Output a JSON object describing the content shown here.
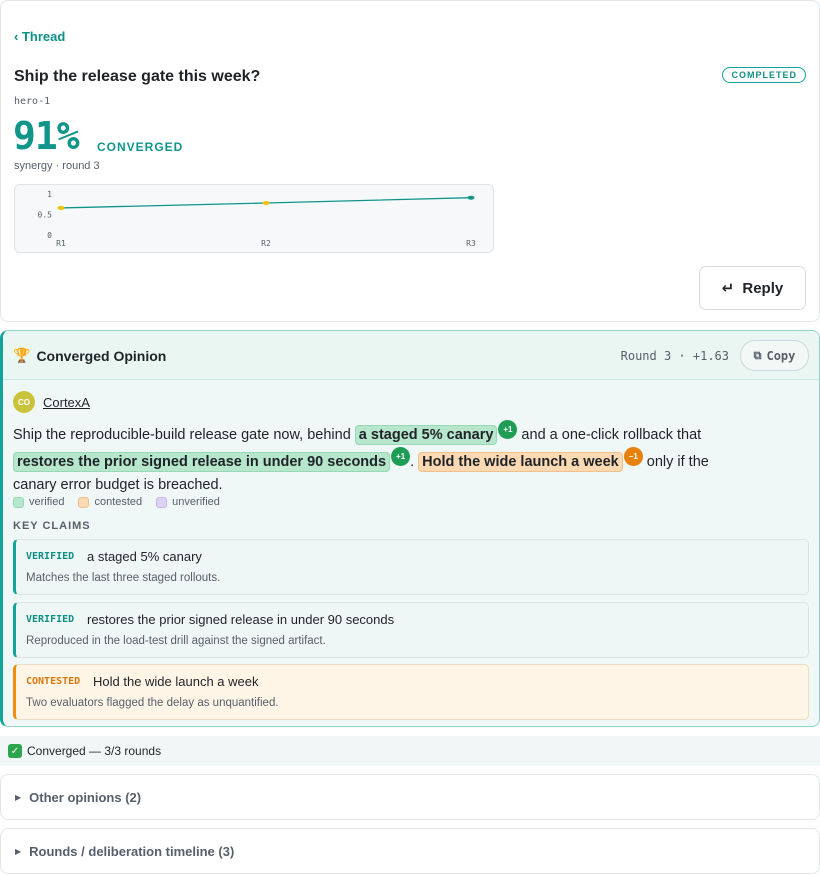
{
  "header": {
    "back_label": "‹ Thread",
    "title": "Ship the release gate this week?",
    "status": "COMPLETED",
    "thread_id": "hero-1",
    "convergence_value": "91%",
    "convergence_label": "CONVERGED",
    "subtitle": "synergy · round 3",
    "reply_label": "Reply"
  },
  "chart_data": {
    "type": "line",
    "x": [
      "R1",
      "R2",
      "R3"
    ],
    "values": [
      0.66,
      0.78,
      0.91
    ],
    "yticks": [
      "1",
      "0.5",
      "0"
    ],
    "ylim": [
      0,
      1
    ],
    "point_colors": [
      "#f2c200",
      "#f2c200",
      "#11958b"
    ],
    "line_color": "#11958b"
  },
  "opinion": {
    "title": "Converged Opinion",
    "meta": "Round 3 · +1.63",
    "copy_label": "Copy",
    "author_initials": "CO",
    "author_name": "CortexA",
    "body": {
      "t1": "Ship the reproducible-build release gate now, behind ",
      "h1": "a staged 5% canary",
      "v1": "+1",
      "t2": " and a one-click rollback that ",
      "h2": "restores the prior signed release in under 90 seconds",
      "v2": "+1",
      "t3": ". ",
      "h3": "Hold the wide launch a week",
      "v3": "−1",
      "t4": " only if the canary error budget is breached."
    },
    "legend": [
      "verified",
      "contested",
      "unverified"
    ],
    "claims_heading": "KEY CLAIMS",
    "claims": [
      {
        "tag": "VERIFIED",
        "text": "a staged 5% canary",
        "note": "Matches the last three staged rollouts."
      },
      {
        "tag": "VERIFIED",
        "text": "restores the prior signed release in under 90 seconds",
        "note": "Reproduced in the load-test drill against the signed artifact."
      },
      {
        "tag": "CONTESTED",
        "text": "Hold the wide launch a week",
        "note": "Two evaluators flagged the delay as unquantified."
      }
    ]
  },
  "footer": {
    "status_text": "Converged — 3/3 rounds",
    "other_opinions": "Other opinions (2)",
    "rounds_timeline": "Rounds / deliberation timeline (3)"
  }
}
